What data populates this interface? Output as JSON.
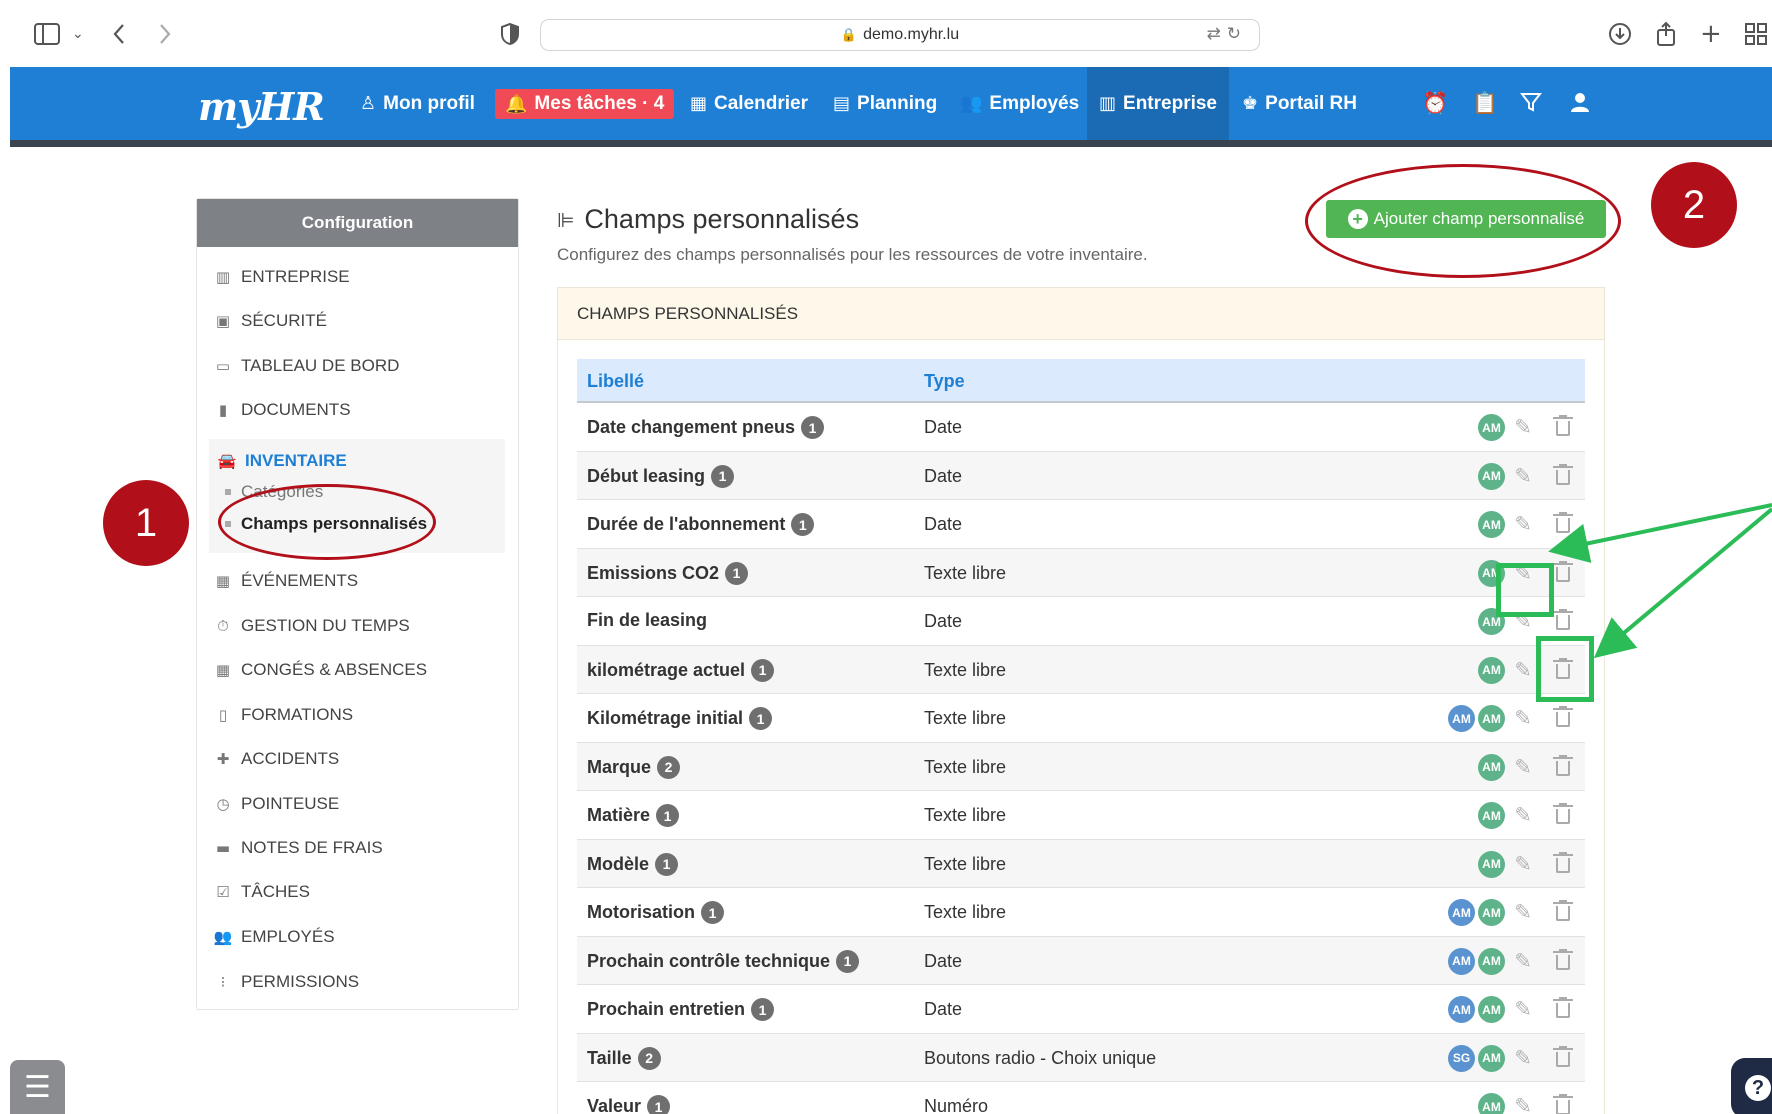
{
  "browser": {
    "url": "demo.myhr.lu"
  },
  "nav": {
    "logo": "myHR",
    "items": [
      {
        "label": "Mon profil",
        "icon": "user-tie-icon"
      },
      {
        "label": "Mes tâches · 4",
        "icon": "bell-icon"
      },
      {
        "label": "Calendrier",
        "icon": "calendar-icon"
      },
      {
        "label": "Planning",
        "icon": "planning-icon"
      },
      {
        "label": "Employés",
        "icon": "users-icon"
      },
      {
        "label": "Entreprise",
        "icon": "building-icon"
      },
      {
        "label": "Portail RH",
        "icon": "portal-icon"
      }
    ],
    "colors": {
      "bar": "#1e7fd5",
      "active": "#1b6bb4",
      "tasks": "#ef4a55"
    }
  },
  "sidebar": {
    "title": "Configuration",
    "items": [
      {
        "label": "ENTREPRISE",
        "icon": "building-icon"
      },
      {
        "label": "SÉCURITÉ",
        "icon": "safe-icon"
      },
      {
        "label": "TABLEAU DE BORD",
        "icon": "monitor-icon"
      },
      {
        "label": "DOCUMENTS",
        "icon": "file-icon"
      },
      {
        "label": "INVENTAIRE",
        "icon": "car-icon"
      },
      {
        "label": "ÉVÉNEMENTS",
        "icon": "calendar-icon"
      },
      {
        "label": "GESTION DU TEMPS",
        "icon": "stopwatch-icon"
      },
      {
        "label": "CONGÉS & ABSENCES",
        "icon": "calendar-off-icon"
      },
      {
        "label": "FORMATIONS",
        "icon": "book-icon"
      },
      {
        "label": "ACCIDENTS",
        "icon": "first-aid-icon"
      },
      {
        "label": "POINTEUSE",
        "icon": "clock-icon"
      },
      {
        "label": "NOTES DE FRAIS",
        "icon": "wallet-icon"
      },
      {
        "label": "TÂCHES",
        "icon": "checkbox-icon"
      },
      {
        "label": "EMPLOYÉS",
        "icon": "users-icon"
      },
      {
        "label": "PERMISSIONS",
        "icon": "traffic-light-icon"
      }
    ],
    "sub_items": [
      {
        "label": "Catégories"
      },
      {
        "label": "Champs personnalisés"
      }
    ]
  },
  "main": {
    "title": "Champs personnalisés",
    "description": "Configurez des champs personnalisés pour les ressources de votre inventaire.",
    "add_button": "Ajouter champ personnalisé",
    "panel_title": "CHAMPS PERSONNALISÉS",
    "columns": [
      "Libellé",
      "Type"
    ],
    "rows": [
      {
        "label": "Date changement pneus",
        "count": "1",
        "type": "Date",
        "avatars": [
          {
            "initials": "AM",
            "color": "green"
          }
        ]
      },
      {
        "label": "Début leasing",
        "count": "1",
        "type": "Date",
        "avatars": [
          {
            "initials": "AM",
            "color": "green"
          }
        ]
      },
      {
        "label": "Durée de l'abonnement",
        "count": "1",
        "type": "Date",
        "avatars": [
          {
            "initials": "AM",
            "color": "green"
          }
        ]
      },
      {
        "label": "Emissions CO2",
        "count": "1",
        "type": "Texte libre",
        "avatars": [
          {
            "initials": "AM",
            "color": "green"
          }
        ]
      },
      {
        "label": "Fin de leasing",
        "count": "",
        "type": "Date",
        "avatars": [
          {
            "initials": "AM",
            "color": "green"
          }
        ]
      },
      {
        "label": "kilométrage actuel",
        "count": "1",
        "type": "Texte libre",
        "avatars": [
          {
            "initials": "AM",
            "color": "green"
          }
        ]
      },
      {
        "label": "Kilométrage initial",
        "count": "1",
        "type": "Texte libre",
        "avatars": [
          {
            "initials": "AM",
            "color": "blue"
          },
          {
            "initials": "AM",
            "color": "green"
          }
        ]
      },
      {
        "label": "Marque",
        "count": "2",
        "type": "Texte libre",
        "avatars": [
          {
            "initials": "AM",
            "color": "green"
          }
        ]
      },
      {
        "label": "Matière",
        "count": "1",
        "type": "Texte libre",
        "avatars": [
          {
            "initials": "AM",
            "color": "green"
          }
        ]
      },
      {
        "label": "Modèle",
        "count": "1",
        "type": "Texte libre",
        "avatars": [
          {
            "initials": "AM",
            "color": "green"
          }
        ]
      },
      {
        "label": "Motorisation",
        "count": "1",
        "type": "Texte libre",
        "avatars": [
          {
            "initials": "AM",
            "color": "blue"
          },
          {
            "initials": "AM",
            "color": "green"
          }
        ]
      },
      {
        "label": "Prochain contrôle technique",
        "count": "1",
        "type": "Date",
        "avatars": [
          {
            "initials": "AM",
            "color": "blue"
          },
          {
            "initials": "AM",
            "color": "green"
          }
        ]
      },
      {
        "label": "Prochain entretien",
        "count": "1",
        "type": "Date",
        "avatars": [
          {
            "initials": "AM",
            "color": "blue"
          },
          {
            "initials": "AM",
            "color": "green"
          }
        ]
      },
      {
        "label": "Taille",
        "count": "2",
        "type": "Boutons radio - Choix unique",
        "avatars": [
          {
            "initials": "SG",
            "color": "blue"
          },
          {
            "initials": "AM",
            "color": "green"
          }
        ]
      },
      {
        "label": "Valeur",
        "count": "1",
        "type": "Numéro",
        "avatars": [
          {
            "initials": "AM",
            "color": "green"
          }
        ]
      }
    ]
  },
  "annotations": {
    "step1": "1",
    "step2": "2",
    "colors": {
      "marker": "#b10f19",
      "highlight": "#2bbb57"
    }
  }
}
